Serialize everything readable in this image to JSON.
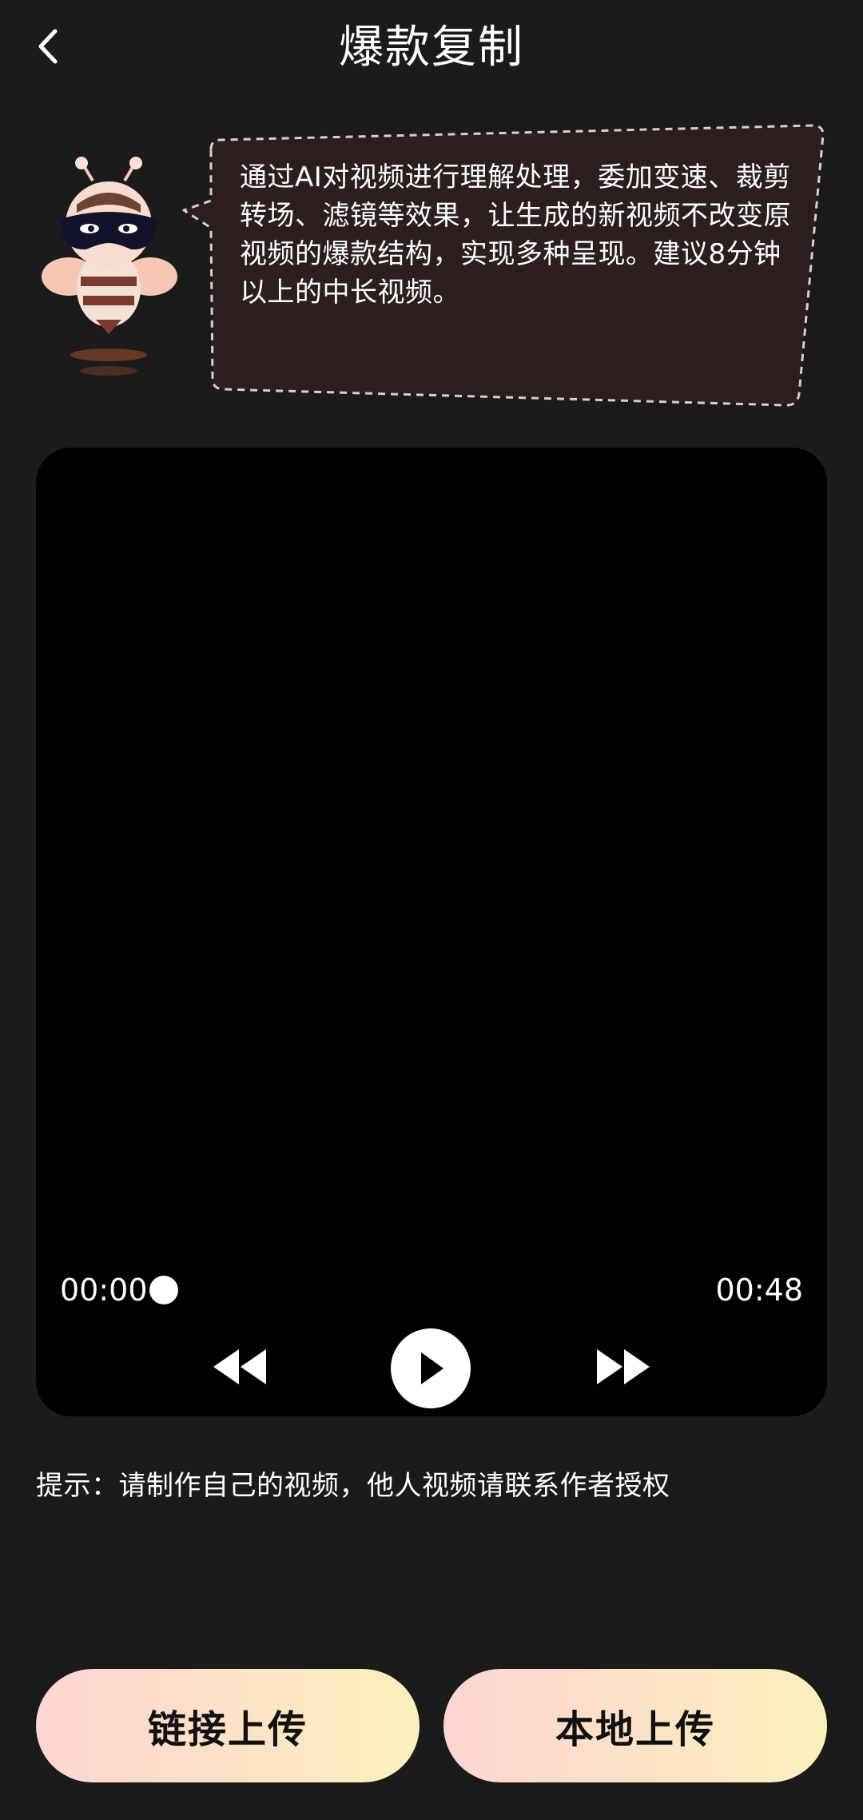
{
  "header": {
    "title": "爆款复制",
    "back_icon": "chevron-left-icon"
  },
  "intro": {
    "mascot_icon": "bee-mascot-icon",
    "description": "通过AI对视频进行理解处理，委加变速、裁剪转场、滤镜等效果，让生成的新视频不改变原视频的爆款结构，实现多种呈现。建议8分钟以上的中长视频。"
  },
  "player": {
    "current_time": "00:00",
    "total_time": "00:48",
    "progress": 0,
    "controls": [
      "rewind-icon",
      "play-icon",
      "fast-forward-icon"
    ]
  },
  "tip": "提示：请制作自己的视频，他人视频请联系作者授权",
  "buttons": {
    "link_upload": "链接上传",
    "local_upload": "本地上传"
  },
  "colors": {
    "background": "#1b1b1b",
    "player_background": "#000000",
    "bubble_fill": "#2d1f1f",
    "button_gradient_start": "#fcd6d2",
    "button_gradient_end": "#fdf0bc"
  }
}
